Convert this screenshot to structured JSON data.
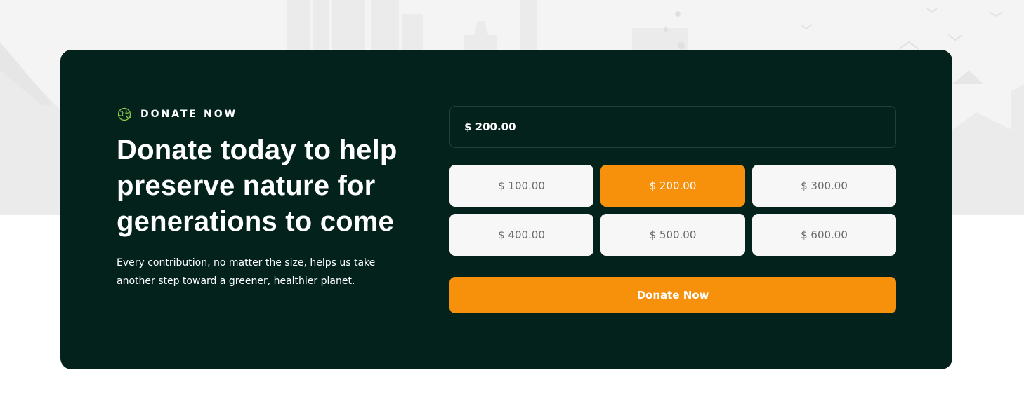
{
  "eyebrow": {
    "icon": "globe-leaf-icon",
    "label": "DONATE NOW"
  },
  "headline": "Donate today to help preserve nature for generations to come",
  "description": "Every contribution, no matter the size, helps us take another step toward a greener, healthier planet.",
  "amount_input": {
    "value": "$ 200.00"
  },
  "amount_options": [
    {
      "label": "$ 100.00",
      "selected": false
    },
    {
      "label": "$ 200.00",
      "selected": true
    },
    {
      "label": "$ 300.00",
      "selected": false
    },
    {
      "label": "$ 400.00",
      "selected": false
    },
    {
      "label": "$ 500.00",
      "selected": false
    },
    {
      "label": "$ 600.00",
      "selected": false
    }
  ],
  "submit_label": "Donate Now",
  "colors": {
    "card_background": "#03221c",
    "accent": "#f7900a",
    "eyebrow_icon": "#8bc34a",
    "option_background": "#f7f7f7",
    "option_text": "#6b6b6b",
    "page_backdrop": "#f4f4f4"
  }
}
